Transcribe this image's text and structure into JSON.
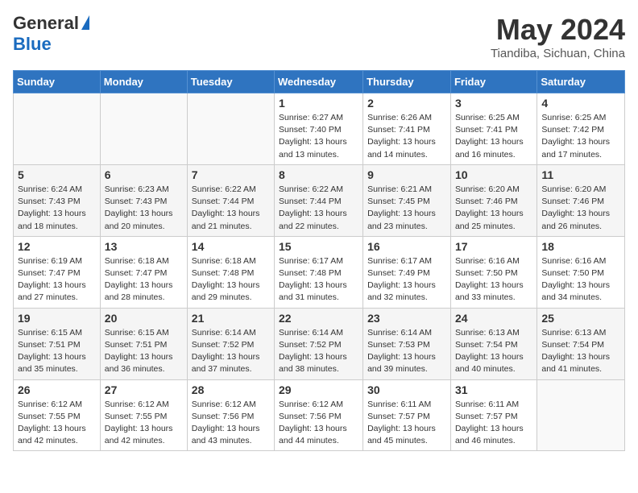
{
  "header": {
    "logo_general": "General",
    "logo_blue": "Blue",
    "month_title": "May 2024",
    "location": "Tiandiba, Sichuan, China"
  },
  "days_of_week": [
    "Sunday",
    "Monday",
    "Tuesday",
    "Wednesday",
    "Thursday",
    "Friday",
    "Saturday"
  ],
  "weeks": [
    [
      {
        "day": "",
        "sunrise": "",
        "sunset": "",
        "daylight": ""
      },
      {
        "day": "",
        "sunrise": "",
        "sunset": "",
        "daylight": ""
      },
      {
        "day": "",
        "sunrise": "",
        "sunset": "",
        "daylight": ""
      },
      {
        "day": "1",
        "sunrise": "6:27 AM",
        "sunset": "7:40 PM",
        "daylight": "13 hours and 13 minutes."
      },
      {
        "day": "2",
        "sunrise": "6:26 AM",
        "sunset": "7:41 PM",
        "daylight": "13 hours and 14 minutes."
      },
      {
        "day": "3",
        "sunrise": "6:25 AM",
        "sunset": "7:41 PM",
        "daylight": "13 hours and 16 minutes."
      },
      {
        "day": "4",
        "sunrise": "6:25 AM",
        "sunset": "7:42 PM",
        "daylight": "13 hours and 17 minutes."
      }
    ],
    [
      {
        "day": "5",
        "sunrise": "6:24 AM",
        "sunset": "7:43 PM",
        "daylight": "13 hours and 18 minutes."
      },
      {
        "day": "6",
        "sunrise": "6:23 AM",
        "sunset": "7:43 PM",
        "daylight": "13 hours and 20 minutes."
      },
      {
        "day": "7",
        "sunrise": "6:22 AM",
        "sunset": "7:44 PM",
        "daylight": "13 hours and 21 minutes."
      },
      {
        "day": "8",
        "sunrise": "6:22 AM",
        "sunset": "7:44 PM",
        "daylight": "13 hours and 22 minutes."
      },
      {
        "day": "9",
        "sunrise": "6:21 AM",
        "sunset": "7:45 PM",
        "daylight": "13 hours and 23 minutes."
      },
      {
        "day": "10",
        "sunrise": "6:20 AM",
        "sunset": "7:46 PM",
        "daylight": "13 hours and 25 minutes."
      },
      {
        "day": "11",
        "sunrise": "6:20 AM",
        "sunset": "7:46 PM",
        "daylight": "13 hours and 26 minutes."
      }
    ],
    [
      {
        "day": "12",
        "sunrise": "6:19 AM",
        "sunset": "7:47 PM",
        "daylight": "13 hours and 27 minutes."
      },
      {
        "day": "13",
        "sunrise": "6:18 AM",
        "sunset": "7:47 PM",
        "daylight": "13 hours and 28 minutes."
      },
      {
        "day": "14",
        "sunrise": "6:18 AM",
        "sunset": "7:48 PM",
        "daylight": "13 hours and 29 minutes."
      },
      {
        "day": "15",
        "sunrise": "6:17 AM",
        "sunset": "7:48 PM",
        "daylight": "13 hours and 31 minutes."
      },
      {
        "day": "16",
        "sunrise": "6:17 AM",
        "sunset": "7:49 PM",
        "daylight": "13 hours and 32 minutes."
      },
      {
        "day": "17",
        "sunrise": "6:16 AM",
        "sunset": "7:50 PM",
        "daylight": "13 hours and 33 minutes."
      },
      {
        "day": "18",
        "sunrise": "6:16 AM",
        "sunset": "7:50 PM",
        "daylight": "13 hours and 34 minutes."
      }
    ],
    [
      {
        "day": "19",
        "sunrise": "6:15 AM",
        "sunset": "7:51 PM",
        "daylight": "13 hours and 35 minutes."
      },
      {
        "day": "20",
        "sunrise": "6:15 AM",
        "sunset": "7:51 PM",
        "daylight": "13 hours and 36 minutes."
      },
      {
        "day": "21",
        "sunrise": "6:14 AM",
        "sunset": "7:52 PM",
        "daylight": "13 hours and 37 minutes."
      },
      {
        "day": "22",
        "sunrise": "6:14 AM",
        "sunset": "7:52 PM",
        "daylight": "13 hours and 38 minutes."
      },
      {
        "day": "23",
        "sunrise": "6:14 AM",
        "sunset": "7:53 PM",
        "daylight": "13 hours and 39 minutes."
      },
      {
        "day": "24",
        "sunrise": "6:13 AM",
        "sunset": "7:54 PM",
        "daylight": "13 hours and 40 minutes."
      },
      {
        "day": "25",
        "sunrise": "6:13 AM",
        "sunset": "7:54 PM",
        "daylight": "13 hours and 41 minutes."
      }
    ],
    [
      {
        "day": "26",
        "sunrise": "6:12 AM",
        "sunset": "7:55 PM",
        "daylight": "13 hours and 42 minutes."
      },
      {
        "day": "27",
        "sunrise": "6:12 AM",
        "sunset": "7:55 PM",
        "daylight": "13 hours and 42 minutes."
      },
      {
        "day": "28",
        "sunrise": "6:12 AM",
        "sunset": "7:56 PM",
        "daylight": "13 hours and 43 minutes."
      },
      {
        "day": "29",
        "sunrise": "6:12 AM",
        "sunset": "7:56 PM",
        "daylight": "13 hours and 44 minutes."
      },
      {
        "day": "30",
        "sunrise": "6:11 AM",
        "sunset": "7:57 PM",
        "daylight": "13 hours and 45 minutes."
      },
      {
        "day": "31",
        "sunrise": "6:11 AM",
        "sunset": "7:57 PM",
        "daylight": "13 hours and 46 minutes."
      },
      {
        "day": "",
        "sunrise": "",
        "sunset": "",
        "daylight": ""
      }
    ]
  ]
}
